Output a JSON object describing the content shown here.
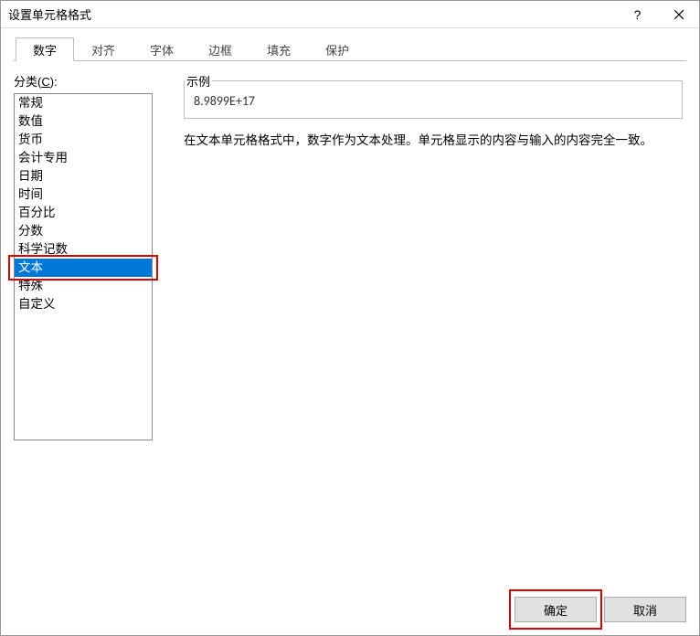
{
  "title": "设置单元格格式",
  "titlebar": {
    "help": "?",
    "close": "×"
  },
  "tabs": [
    {
      "label": "数字",
      "active": true
    },
    {
      "label": "对齐",
      "active": false
    },
    {
      "label": "字体",
      "active": false
    },
    {
      "label": "边框",
      "active": false
    },
    {
      "label": "填充",
      "active": false
    },
    {
      "label": "保护",
      "active": false
    }
  ],
  "category_label_prefix": "分类(",
  "category_label_hotkey": "C",
  "category_label_suffix": "):",
  "categories": [
    "常规",
    "数值",
    "货币",
    "会计专用",
    "日期",
    "时间",
    "百分比",
    "分数",
    "科学记数",
    "文本",
    "特殊",
    "自定义"
  ],
  "selected_category_index": 9,
  "example": {
    "title": "示例",
    "value": "8.9899E+17"
  },
  "description": "在文本单元格格式中，数字作为文本处理。单元格显示的内容与输入的内容完全一致。",
  "buttons": {
    "ok": "确定",
    "cancel": "取消"
  },
  "highlights": {
    "accent_red": "#d00",
    "selection_bg": "#0078d7"
  }
}
